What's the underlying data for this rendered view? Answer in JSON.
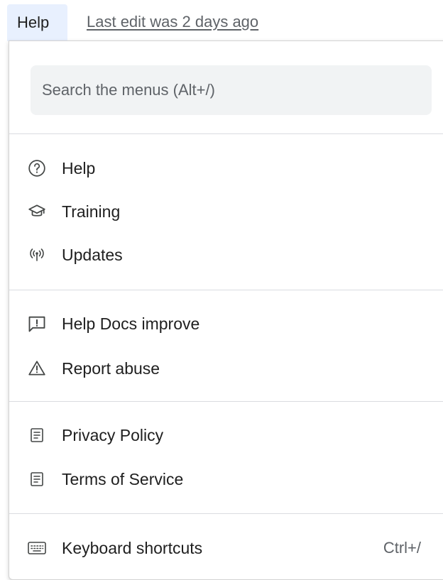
{
  "topbar": {
    "help_tab": "Help",
    "last_edit": "Last edit was 2 days ago"
  },
  "menu": {
    "search": {
      "placeholder": "Search the menus (Alt+/)"
    },
    "items": [
      {
        "label": "Help",
        "icon": "help-circle-icon"
      },
      {
        "label": "Training",
        "icon": "graduation-cap-icon"
      },
      {
        "label": "Updates",
        "icon": "broadcast-icon"
      },
      {
        "label": "Help Docs improve",
        "icon": "feedback-icon"
      },
      {
        "label": "Report abuse",
        "icon": "warning-icon"
      },
      {
        "label": "Privacy Policy",
        "icon": "document-icon"
      },
      {
        "label": "Terms of Service",
        "icon": "document-icon"
      },
      {
        "label": "Keyboard shortcuts",
        "icon": "keyboard-icon",
        "shortcut": "Ctrl+/"
      }
    ]
  }
}
